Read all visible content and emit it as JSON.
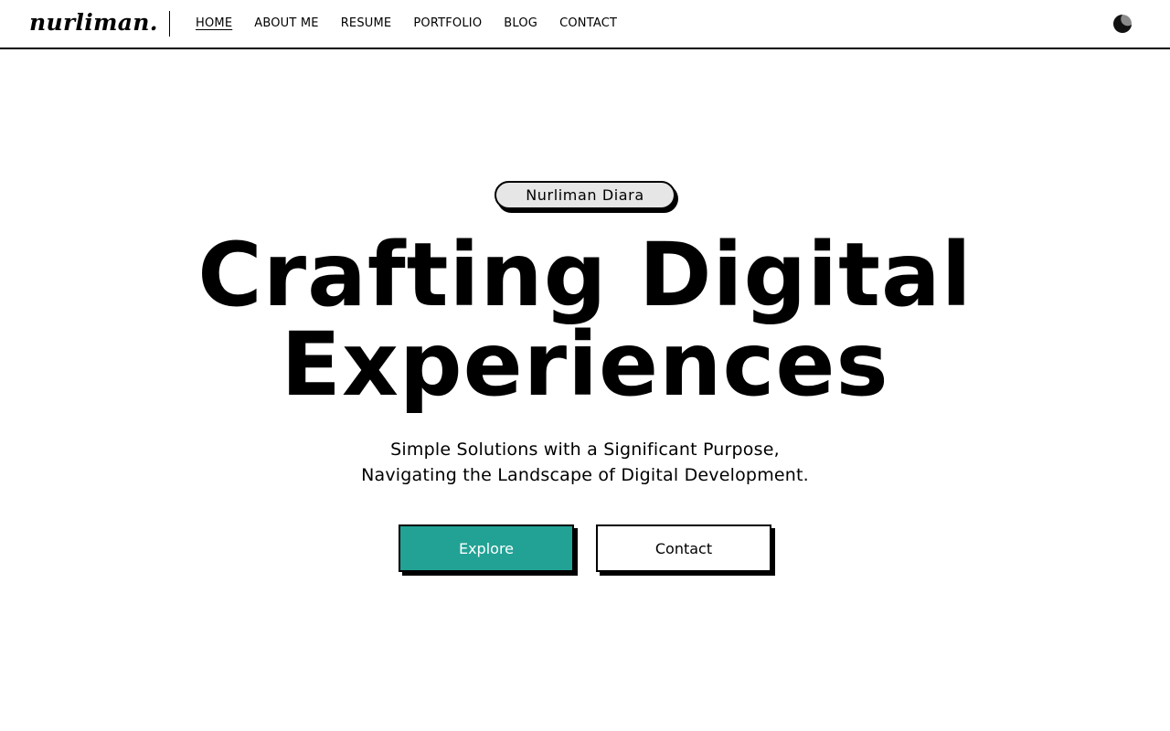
{
  "header": {
    "logo": "nurliman.",
    "nav": [
      {
        "label": "HOME",
        "active": true
      },
      {
        "label": "ABOUT ME",
        "active": false
      },
      {
        "label": "RESUME",
        "active": false
      },
      {
        "label": "PORTFOLIO",
        "active": false
      },
      {
        "label": "BLOG",
        "active": false
      },
      {
        "label": "CONTACT",
        "active": false
      }
    ],
    "theme_toggle_icon": "moon-icon"
  },
  "hero": {
    "name_badge": "Nurliman Diara",
    "headline_line1": "Crafting Digital",
    "headline_line2": "Experiences",
    "subtitle_line1": "Simple Solutions with a Significant Purpose,",
    "subtitle_line2": "Navigating the Landscape of Digital Development.",
    "explore_label": "Explore",
    "contact_label": "Contact"
  },
  "colors": {
    "accent": "#22a295",
    "text": "#000000",
    "background": "#ffffff",
    "badge_bg": "#e6e6e6"
  }
}
